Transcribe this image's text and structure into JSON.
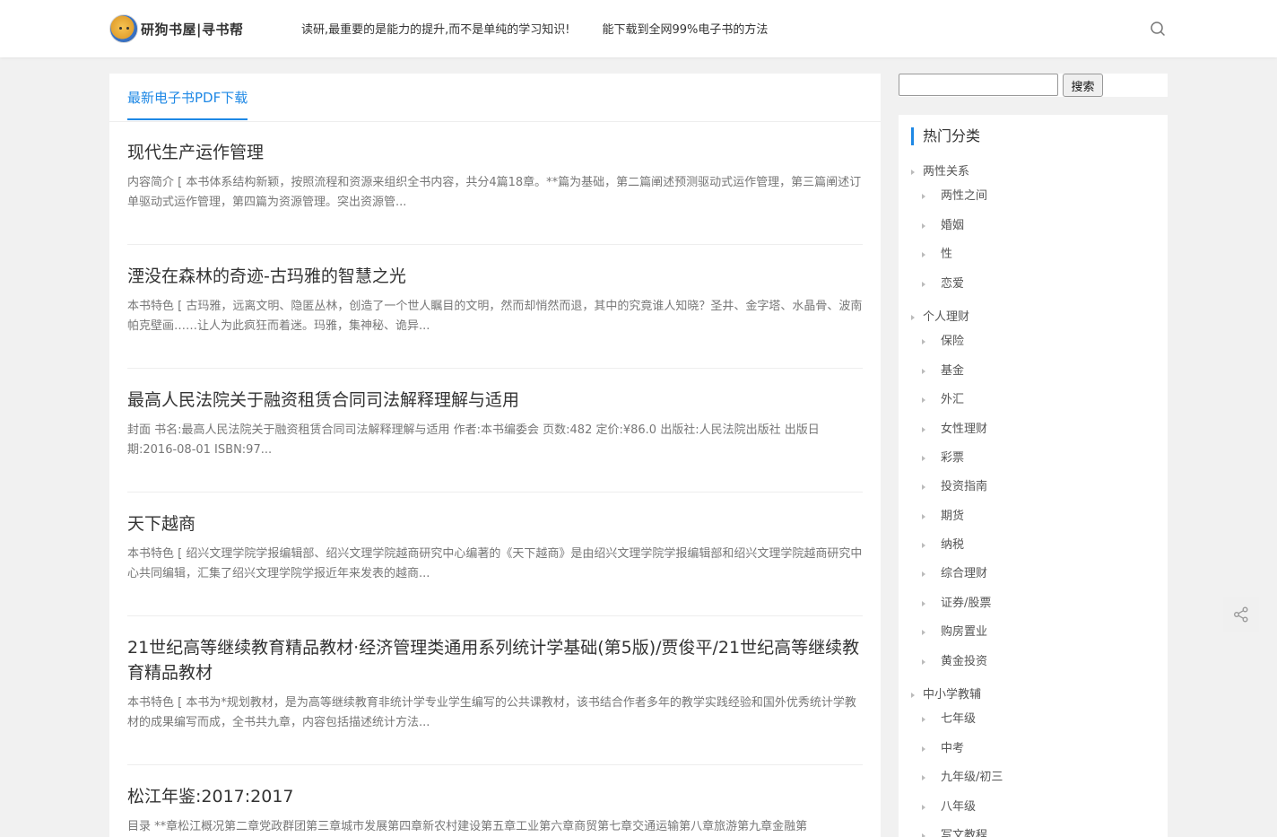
{
  "header": {
    "logo_text": "研狗书屋|寻书帮",
    "nav": [
      "读研,最重要的是能力的提升,而不是单纯的学习知识!",
      "能下载到全网99%电子书的方法"
    ]
  },
  "main": {
    "tab_label": "最新电子书PDF下载",
    "posts": [
      {
        "title": "现代生产运作管理",
        "excerpt": "内容简介 [ 本书体系结构新颖，按照流程和资源来组织全书内容，共分4篇18章。**篇为基础，第二篇阐述预测驱动式运作管理，第三篇阐述订单驱动式运作管理，第四篇为资源管理。突出资源管..."
      },
      {
        "title": "湮没在森林的奇迹-古玛雅的智慧之光",
        "excerpt": "本书特色 [ 古玛雅，远离文明、隐匿丛林，创造了一个世人瞩目的文明，然而却悄然而退，其中的究竟谁人知晓？圣井、金字塔、水晶骨、波南帕克壁画……让人为此疯狂而着迷。玛雅，集神秘、诡异..."
      },
      {
        "title": "最高人民法院关于融资租赁合同司法解释理解与适用",
        "excerpt": "封面 书名:最高人民法院关于融资租赁合同司法解释理解与适用 作者:本书编委会 页数:482 定价:¥86.0 出版社:人民法院出版社 出版日期:2016-08-01 ISBN:97..."
      },
      {
        "title": "天下越商",
        "excerpt": "本书特色 [ 绍兴文理学院学报编辑部、绍兴文理学院越商研究中心编著的《天下越商》是由绍兴文理学院学报编辑部和绍兴文理学院越商研究中心共同编辑，汇集了绍兴文理学院学报近年来发表的越商..."
      },
      {
        "title": "21世纪高等继续教育精品教材·经济管理类通用系列统计学基础(第5版)/贾俊平/21世纪高等继续教育精品教材",
        "excerpt": "本书特色 [ 本书为*规划教材，是为高等继续教育非统计学专业学生编写的公共课教材，该书结合作者多年的教学实践经验和国外优秀统计学教材的成果编写而成，全书共九章，内容包括描述统计方法..."
      },
      {
        "title": "松江年鉴:2017:2017",
        "excerpt": "目录 **章松江概况第二章党政群团第三章城市发展第四章新农村建设第五章工业第六章商贸第七章交通运输第八章旅游第九章金融第"
      }
    ]
  },
  "sidebar": {
    "search_button": "搜索",
    "search_value": "",
    "widget_title": "热门分类",
    "categories": [
      {
        "label": "两性关系",
        "children": [
          "两性之间",
          "婚姻",
          "性",
          "恋爱"
        ]
      },
      {
        "label": "个人理财",
        "children": [
          "保险",
          "基金",
          "外汇",
          "女性理财",
          "彩票",
          "投资指南",
          "期货",
          "纳税",
          "综合理财",
          "证券/股票",
          "购房置业",
          "黄金投资"
        ]
      },
      {
        "label": "中小学教辅",
        "children": [
          "七年级",
          "中考",
          "九年级/初三",
          "八年级",
          "写文教程"
        ]
      }
    ]
  },
  "colors": {
    "accent": "#1e88e5",
    "page_bg": "#f1f1f1"
  },
  "icons": {
    "search": "search-icon",
    "share": "share-icon"
  }
}
